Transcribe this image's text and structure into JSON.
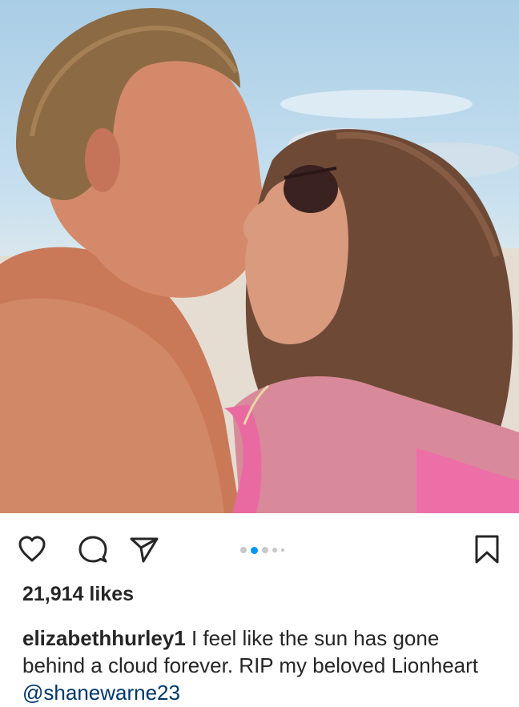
{
  "post": {
    "likes_text": "21,914 likes",
    "caption": {
      "username": "elizabethhurley1",
      "text": " I feel like the sun has gone behind a cloud forever. RIP my beloved Lionheart ",
      "mention": "@shanewarne23"
    },
    "carousel": {
      "count": 5,
      "active_index": 1
    }
  },
  "icons": {
    "like": "heart-outline-icon",
    "comment": "comment-bubble-icon",
    "share": "paper-plane-icon",
    "save": "bookmark-outline-icon"
  },
  "colors": {
    "text": "#262626",
    "active_dot": "#0095f6",
    "inactive_dot": "#c8c8c8",
    "mention": "#00376b"
  }
}
